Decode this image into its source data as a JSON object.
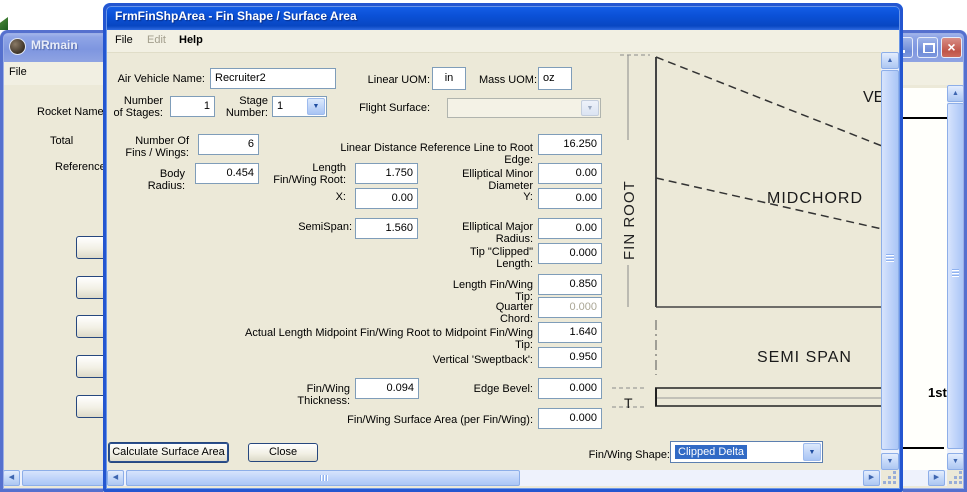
{
  "icons": {
    "up_arrow": "▲",
    "down_arrow": "▼",
    "left_arrow": "◀",
    "right_arrow": "▶",
    "combo_arrow": "▼",
    "close_glyph": "×"
  },
  "main_window": {
    "title": "MRmain",
    "menu": {
      "file": "File"
    },
    "labels": {
      "rocket_name": "Rocket Name:",
      "total": "Total",
      "reference": "Reference"
    },
    "content": {
      "stage_text": "1st"
    }
  },
  "dialog": {
    "title": "FrmFinShpArea - Fin Shape / Surface Area",
    "menu": {
      "file": "File",
      "edit": "Edit",
      "help": "Help"
    },
    "fields": {
      "air_vehicle_name": {
        "label": "Air Vehicle Name:",
        "value": "Recruiter2"
      },
      "linear_uom": {
        "label": "Linear UOM:",
        "value": "in"
      },
      "mass_uom": {
        "label": "Mass UOM:",
        "value": "oz"
      },
      "number_of_stages": {
        "label": "Number\nof Stages:",
        "value": "1"
      },
      "stage_number": {
        "label": "Stage\nNumber:",
        "value": "1"
      },
      "flight_surface": {
        "label": "Flight Surface:",
        "value": ""
      },
      "number_of_fins": {
        "label": "Number Of\nFins / Wings:",
        "value": "6"
      },
      "linear_distance": {
        "label": "Linear Distance Reference Line to Root Edge:",
        "value": "16.250"
      },
      "body_radius": {
        "label": "Body Radius:",
        "value": "0.454"
      },
      "length_fin_root": {
        "label": "Length\nFin/Wing Root:",
        "value": "1.750"
      },
      "elliptical_minor": {
        "label": "Elliptical Minor Diameter",
        "value": "0.00"
      },
      "x": {
        "label": "X:",
        "value": "0.00"
      },
      "y": {
        "label": "Y:",
        "value": "0.00"
      },
      "semispan": {
        "label": "SemiSpan:",
        "value": "1.560"
      },
      "elliptical_major": {
        "label": "Elliptical Major Radius:",
        "value": "0.00"
      },
      "tip_clipped_length": {
        "label": "Tip \"Clipped\" Length:",
        "value": "0.000"
      },
      "length_fin_tip": {
        "label": "Length Fin/Wing Tip:",
        "value": "0.850"
      },
      "quarter_chord": {
        "label": "Quarter Chord:",
        "value": "0.000"
      },
      "actual_length_midpoint": {
        "label": "Actual Length Midpoint Fin/Wing Root to Midpoint Fin/Wing Tip:",
        "value": "1.640"
      },
      "vertical_sweptback": {
        "label": "Vertical 'Sweptback':",
        "value": "0.950"
      },
      "fin_thickness": {
        "label": "Fin/Wing Thickness:",
        "value": "0.094"
      },
      "edge_bevel": {
        "label": "Edge Bevel:",
        "value": "0.000"
      },
      "surface_area": {
        "label": "Fin/Wing Surface Area (per Fin/Wing):",
        "value": "0.000"
      },
      "fin_shape": {
        "label": "Fin/Wing Shape:",
        "value": "Clipped Delta"
      }
    },
    "buttons": {
      "calculate": "Calculate Surface Area",
      "close": "Close"
    },
    "diagram": {
      "fin_root": "FIN ROOT",
      "vertical": "VERTICAL",
      "midchord": "MIDCHORD",
      "semi_span": "SEMI SPAN",
      "thickness": "T"
    }
  },
  "colors": {
    "active_title_blue": "#0b51d8",
    "selection_blue": "#316ac5",
    "client_beige": "#ece9d8",
    "field_border": "#7f9db9"
  }
}
